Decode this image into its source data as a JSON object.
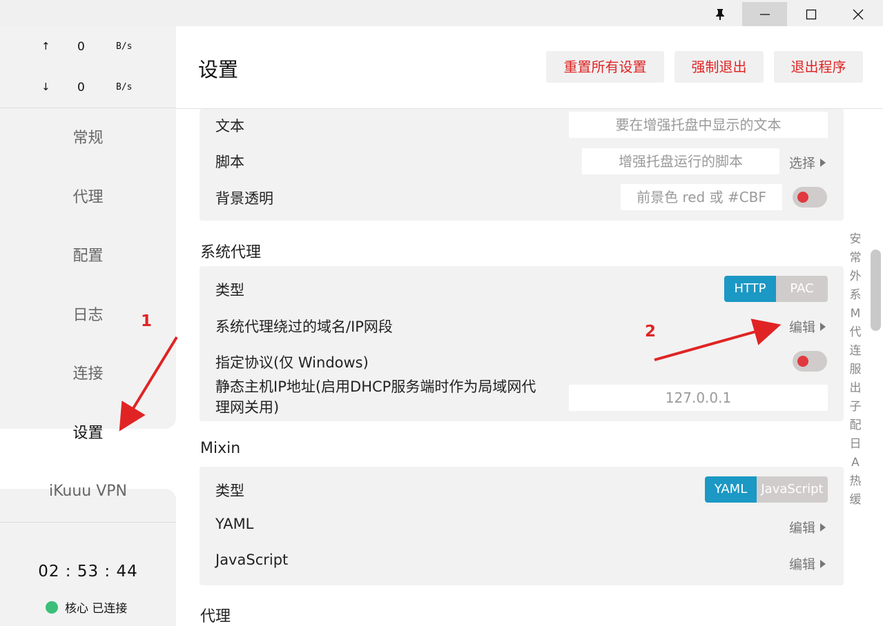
{
  "window": {
    "pin_icon": "pin-icon",
    "minimize_icon": "minimize-icon",
    "maximize_icon": "maximize-icon",
    "close_icon": "close-icon"
  },
  "sidebar": {
    "upload": {
      "arrow": "↑",
      "value": "0",
      "unit": "B/s"
    },
    "download": {
      "arrow": "↓",
      "value": "0",
      "unit": "B/s"
    },
    "nav": [
      "常规",
      "代理",
      "配置",
      "日志",
      "连接",
      "设置",
      "iKuuu VPN"
    ],
    "active": "设置",
    "timer": "02 : 53 : 44",
    "core_status": "核心 已连接",
    "core_color": "#3cbf7a"
  },
  "header": {
    "title": "设置",
    "buttons": [
      "重置所有设置",
      "强制退出",
      "退出程序"
    ],
    "button_color": "#e02424"
  },
  "tray_card": {
    "text_label": "文本",
    "text_placeholder": "要在增强托盘中显示的文本",
    "script_label": "脚本",
    "script_placeholder": "增强托盘运行的脚本",
    "script_link": "选择",
    "bg_label": "背景透明",
    "bg_placeholder": "前景色 red 或 #CBF",
    "bg_toggle": false
  },
  "system_proxy": {
    "title": "系统代理",
    "type_label": "类型",
    "type_options": [
      "HTTP",
      "PAC"
    ],
    "type_selected": "HTTP",
    "bypass_label": "系统代理绕过的域名/IP网段",
    "bypass_link": "编辑",
    "protocol_label": "指定协议(仅 Windows)",
    "protocol_toggle": false,
    "static_ip_label_line1": "静态主机IP地址(启用DHCP服务端时作为局域网代",
    "static_ip_label_line2": "理网关用)",
    "static_ip_value": "127.0.0.1"
  },
  "mixin": {
    "title": "Mixin",
    "type_label": "类型",
    "type_options": [
      "YAML",
      "JavaScript"
    ],
    "type_selected": "YAML",
    "yaml_label": "YAML",
    "yaml_link": "编辑",
    "js_label": "JavaScript",
    "js_link": "编辑"
  },
  "proxy_section": {
    "title": "代理"
  },
  "annotations": {
    "one": "1",
    "two": "2",
    "color": "#e02424"
  },
  "alphabet_index": [
    "安",
    "常",
    "外",
    "系",
    "M",
    "代",
    "连",
    "服",
    "出",
    "子",
    "配",
    "日",
    "A",
    "热",
    "缓"
  ],
  "colors": {
    "accent": "#1b98c4",
    "toggle_knob": "#e0393e"
  }
}
